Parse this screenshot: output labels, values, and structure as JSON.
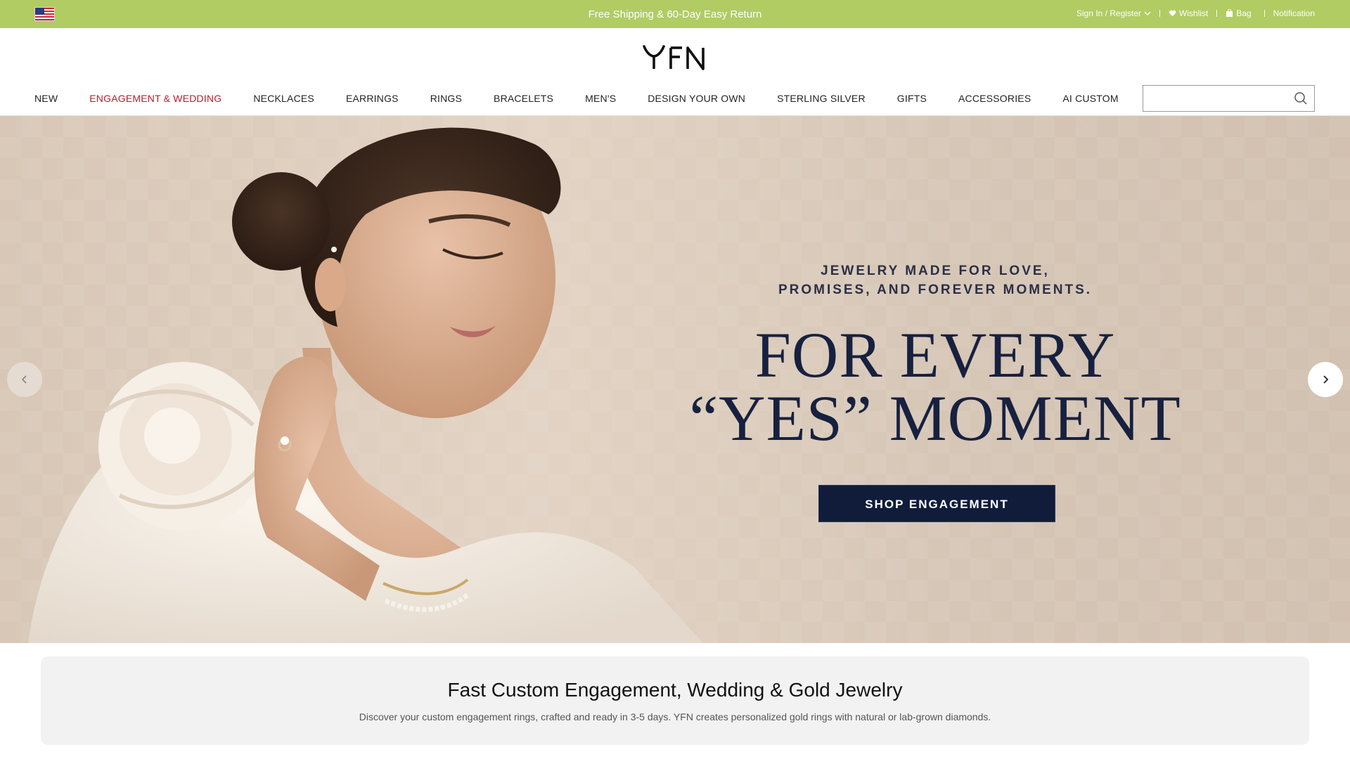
{
  "topbar": {
    "background": "#b0cc63",
    "flag_icon": "us-flag-icon",
    "promo_text": "Free Shipping & 60-Day Easy Return",
    "links": {
      "sign_in": "Sign In / Register",
      "wishlist": "Wishlist",
      "bag": "Bag",
      "notification": "Notification"
    }
  },
  "header": {
    "logo_text": "YFN",
    "search": {
      "value": "",
      "placeholder": ""
    }
  },
  "nav": {
    "items": [
      {
        "label": "NEW",
        "active": false
      },
      {
        "label": "ENGAGEMENT & WEDDING",
        "active": true
      },
      {
        "label": "NECKLACES",
        "active": false
      },
      {
        "label": "EARRINGS",
        "active": false
      },
      {
        "label": "RINGS",
        "active": false
      },
      {
        "label": "BRACELETS",
        "active": false
      },
      {
        "label": "MEN'S",
        "active": false
      },
      {
        "label": "DESIGN YOUR OWN",
        "active": false
      },
      {
        "label": "STERLING SILVER",
        "active": false
      },
      {
        "label": "GIFTS",
        "active": false
      },
      {
        "label": "ACCESSORIES",
        "active": false
      },
      {
        "label": "AI CUSTOM",
        "active": false
      }
    ],
    "active_color": "#b3202b"
  },
  "hero": {
    "eyebrow": "JEWELRY MADE FOR LOVE,\nPROMISES, AND FOREVER MOMENTS.",
    "title": "FOR EVERY\n“YES” MOMENT",
    "cta_label": "SHOP ENGAGEMENT",
    "cta_color": "#101c3a",
    "title_color": "#17213f"
  },
  "info": {
    "heading": "Fast Custom Engagement, Wedding & Gold Jewelry",
    "description": "Discover your custom engagement rings, crafted and ready in 3-5 days. YFN creates personalized gold rings with natural or lab-grown diamonds."
  }
}
